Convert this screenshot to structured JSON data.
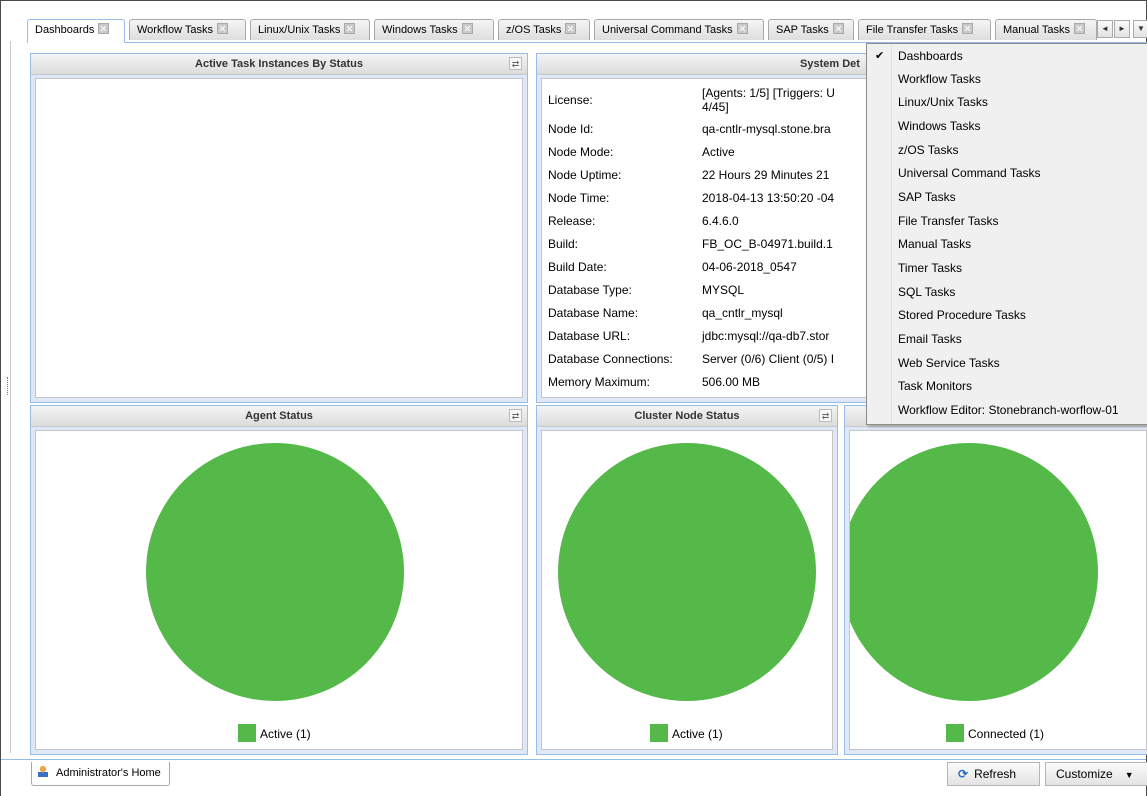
{
  "tabs": [
    {
      "label": "Dashboards",
      "active": true
    },
    {
      "label": "Workflow Tasks"
    },
    {
      "label": "Linux/Unix Tasks"
    },
    {
      "label": "Windows Tasks"
    },
    {
      "label": "z/OS Tasks"
    },
    {
      "label": "Universal Command Tasks"
    },
    {
      "label": "SAP Tasks"
    },
    {
      "label": "File Transfer Tasks"
    },
    {
      "label": "Manual Tasks"
    }
  ],
  "tab_scroll": {
    "left": "◄",
    "right": "►",
    "menu": "▼"
  },
  "panels": {
    "active_tasks": {
      "title": "Active Task Instances By Status"
    },
    "system_details": {
      "title": "System Det",
      "rows": [
        {
          "key": "License:",
          "value_line1": "[Agents: 1/5] [Triggers: U",
          "value_line2": "4/45]"
        },
        {
          "key": "Node Id:",
          "value": "qa-cntlr-mysql.stone.bra"
        },
        {
          "key": "Node Mode:",
          "value": "Active"
        },
        {
          "key": "Node Uptime:",
          "value": "22 Hours 29 Minutes 21"
        },
        {
          "key": "Node Time:",
          "value": "2018-04-13 13:50:20 -04"
        },
        {
          "key": "Release:",
          "value": "6.4.6.0"
        },
        {
          "key": "Build:",
          "value": "FB_OC_B-04971.build.1"
        },
        {
          "key": "Build Date:",
          "value": "04-06-2018_0547"
        },
        {
          "key": "Database Type:",
          "value": "MYSQL"
        },
        {
          "key": "Database Name:",
          "value": "qa_cntlr_mysql"
        },
        {
          "key": "Database URL:",
          "value": "jdbc:mysql://qa-db7.stor"
        },
        {
          "key": "Database Connections:",
          "value": "Server (0/6) Client (0/5) I"
        },
        {
          "key": "Memory Maximum:",
          "value": "506.00 MB"
        }
      ]
    },
    "agent_status": {
      "title": "Agent Status",
      "legend": "Active (1)"
    },
    "cluster_node_status": {
      "title": "Cluster Node Status",
      "legend": "Active (1)"
    },
    "third": {
      "title": "",
      "legend": "Connected (1)"
    }
  },
  "chart_data": [
    {
      "type": "pie",
      "title": "Agent Status",
      "slices": [
        {
          "label": "Active (1)",
          "value": 1,
          "color": "#54b948"
        }
      ]
    },
    {
      "type": "pie",
      "title": "Cluster Node Status",
      "slices": [
        {
          "label": "Active (1)",
          "value": 1,
          "color": "#54b948"
        }
      ]
    },
    {
      "type": "pie",
      "title": "",
      "slices": [
        {
          "label": "Connected (1)",
          "value": 1,
          "color": "#54b948"
        }
      ]
    }
  ],
  "colors": {
    "pie_green": "#54b948",
    "panel_border": "#99bbe8",
    "panel_bg": "#dfe8f6"
  },
  "menu": {
    "items": [
      {
        "label": "Dashboards",
        "checked": true
      },
      {
        "label": "Workflow Tasks"
      },
      {
        "label": "Linux/Unix Tasks"
      },
      {
        "label": "Windows Tasks"
      },
      {
        "label": "z/OS Tasks"
      },
      {
        "label": "Universal Command Tasks"
      },
      {
        "label": "SAP Tasks"
      },
      {
        "label": "File Transfer Tasks"
      },
      {
        "label": "Manual Tasks"
      },
      {
        "label": "Timer Tasks"
      },
      {
        "label": "SQL Tasks"
      },
      {
        "label": "Stored Procedure Tasks"
      },
      {
        "label": "Email Tasks"
      },
      {
        "label": "Web Service Tasks"
      },
      {
        "label": "Task Monitors"
      },
      {
        "label": "Workflow Editor: Stonebranch-worflow-01"
      }
    ],
    "check_glyph": "✔"
  },
  "bottom": {
    "home_tab": "Administrator's Home",
    "refresh": "Refresh",
    "customize": "Customize"
  }
}
